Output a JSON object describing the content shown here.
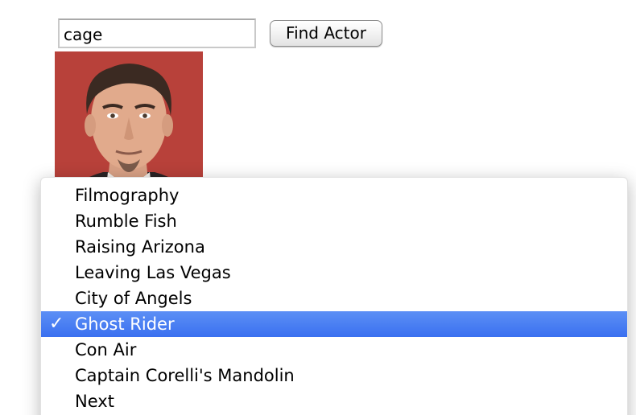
{
  "search": {
    "value": "cage",
    "button_label": "Find Actor"
  },
  "actor_photo": {
    "background": "#b8413a"
  },
  "menu": {
    "selected_index": 5,
    "check_glyph": "✓",
    "items": [
      {
        "label": "Filmography"
      },
      {
        "label": "Rumble Fish"
      },
      {
        "label": "Raising Arizona"
      },
      {
        "label": "Leaving Las Vegas"
      },
      {
        "label": "City of Angels"
      },
      {
        "label": "Ghost Rider"
      },
      {
        "label": "Con Air"
      },
      {
        "label": "Captain Corelli's Mandolin"
      },
      {
        "label": "Next"
      }
    ]
  },
  "colors": {
    "selection": "#3a70f0",
    "photo_background": "#b8413a"
  }
}
